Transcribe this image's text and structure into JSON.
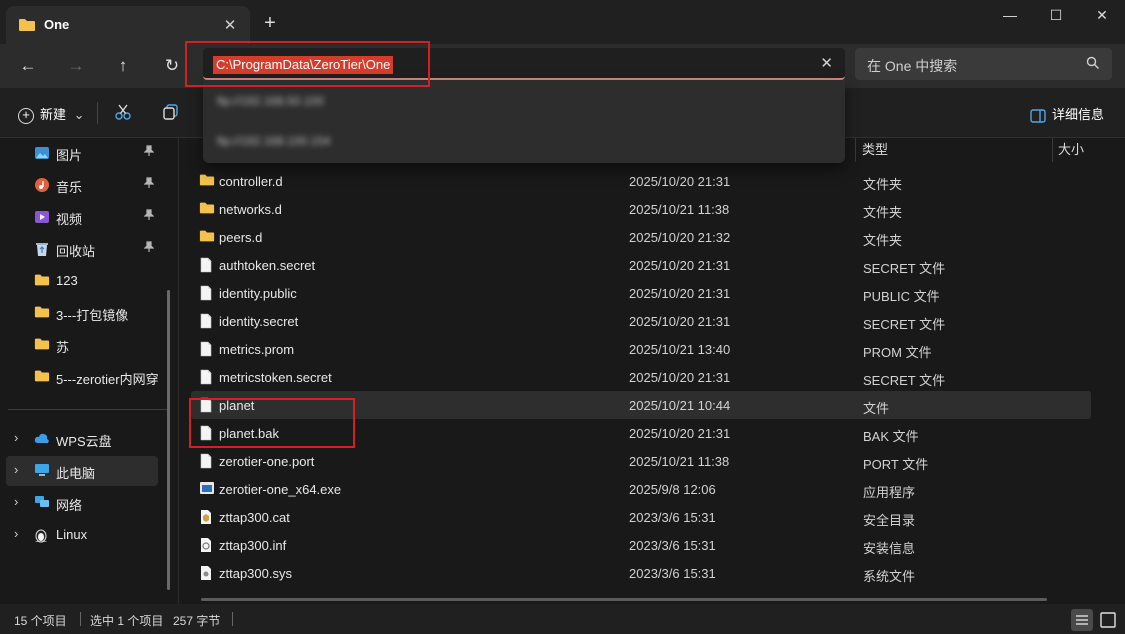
{
  "window": {
    "tab_title": "One",
    "new_tab_symbol": "+",
    "tab_close_symbol": "✕",
    "minimize_symbol": "—",
    "maximize_symbol": "☐",
    "close_symbol": "✕"
  },
  "nav": {
    "back_symbol": "←",
    "forward_symbol": "→",
    "up_symbol": "↑",
    "refresh_symbol": "↻",
    "address": "C:\\ProgramData\\ZeroTier\\One",
    "clear_symbol": "✕",
    "search_placeholder": "在 One 中搜索"
  },
  "address_suggestions": [
    "ftp://192.168.50.100",
    "ftp://192.168.100.154"
  ],
  "toolbar": {
    "new_label": "新建",
    "new_chevron": "⌄",
    "details_label": "详细信息"
  },
  "sidebar": {
    "quick_access": [
      {
        "label": "图片",
        "icon": "pictures-icon",
        "pinned": true
      },
      {
        "label": "音乐",
        "icon": "music-icon",
        "pinned": true
      },
      {
        "label": "视频",
        "icon": "videos-icon",
        "pinned": true
      },
      {
        "label": "回收站",
        "icon": "recycle-bin-icon",
        "pinned": true
      },
      {
        "label": "123",
        "icon": "folder-icon",
        "pinned": false
      },
      {
        "label": "3---打包镜像",
        "icon": "folder-icon",
        "pinned": false
      },
      {
        "label": "苏",
        "icon": "folder-icon",
        "pinned": false
      },
      {
        "label": "5---zerotier内网穿",
        "icon": "folder-icon",
        "pinned": false
      }
    ],
    "pin_symbol": "📌",
    "chevron_symbol": "›",
    "locations": [
      {
        "label": "WPS云盘",
        "icon": "wps-cloud-icon"
      },
      {
        "label": "此电脑",
        "icon": "this-pc-icon",
        "selected": true
      },
      {
        "label": "网络",
        "icon": "network-icon"
      },
      {
        "label": "Linux",
        "icon": "linux-icon"
      }
    ]
  },
  "columns": {
    "type": "类型",
    "size": "大小"
  },
  "files": [
    {
      "name": "controller.d",
      "date": "2025/10/20 21:31",
      "type": "文件夹",
      "icon": "folder-icon"
    },
    {
      "name": "networks.d",
      "date": "2025/10/21 11:38",
      "type": "文件夹",
      "icon": "folder-icon"
    },
    {
      "name": "peers.d",
      "date": "2025/10/20 21:32",
      "type": "文件夹",
      "icon": "folder-icon"
    },
    {
      "name": "authtoken.secret",
      "date": "2025/10/20 21:31",
      "type": "SECRET 文件",
      "icon": "file-icon"
    },
    {
      "name": "identity.public",
      "date": "2025/10/20 21:31",
      "type": "PUBLIC 文件",
      "icon": "file-icon"
    },
    {
      "name": "identity.secret",
      "date": "2025/10/20 21:31",
      "type": "SECRET 文件",
      "icon": "file-icon"
    },
    {
      "name": "metrics.prom",
      "date": "2025/10/21 13:40",
      "type": "PROM 文件",
      "icon": "file-icon"
    },
    {
      "name": "metricstoken.secret",
      "date": "2025/10/20 21:31",
      "type": "SECRET 文件",
      "icon": "file-icon"
    },
    {
      "name": "planet",
      "date": "2025/10/21 10:44",
      "type": "文件",
      "icon": "file-icon",
      "selected": true
    },
    {
      "name": "planet.bak",
      "date": "2025/10/20 21:31",
      "type": "BAK 文件",
      "icon": "file-icon"
    },
    {
      "name": "zerotier-one.port",
      "date": "2025/10/21 11:38",
      "type": "PORT 文件",
      "icon": "file-icon"
    },
    {
      "name": "zerotier-one_x64.exe",
      "date": "2025/9/8 12:06",
      "type": "应用程序",
      "icon": "exe-icon"
    },
    {
      "name": "zttap300.cat",
      "date": "2023/3/6 15:31",
      "type": "安全目录",
      "icon": "security-catalog-icon"
    },
    {
      "name": "zttap300.inf",
      "date": "2023/3/6 15:31",
      "type": "安装信息",
      "icon": "setup-info-icon"
    },
    {
      "name": "zttap300.sys",
      "date": "2023/3/6 15:31",
      "type": "系统文件",
      "icon": "system-file-icon"
    }
  ],
  "status": {
    "item_count": "15 个项目",
    "selection": "选中 1 个项目",
    "size": "257 字节"
  },
  "colors": {
    "address_highlight": "#d43d2c",
    "annotation_red": "#d42020",
    "folder_yellow": "#f2c14e"
  }
}
